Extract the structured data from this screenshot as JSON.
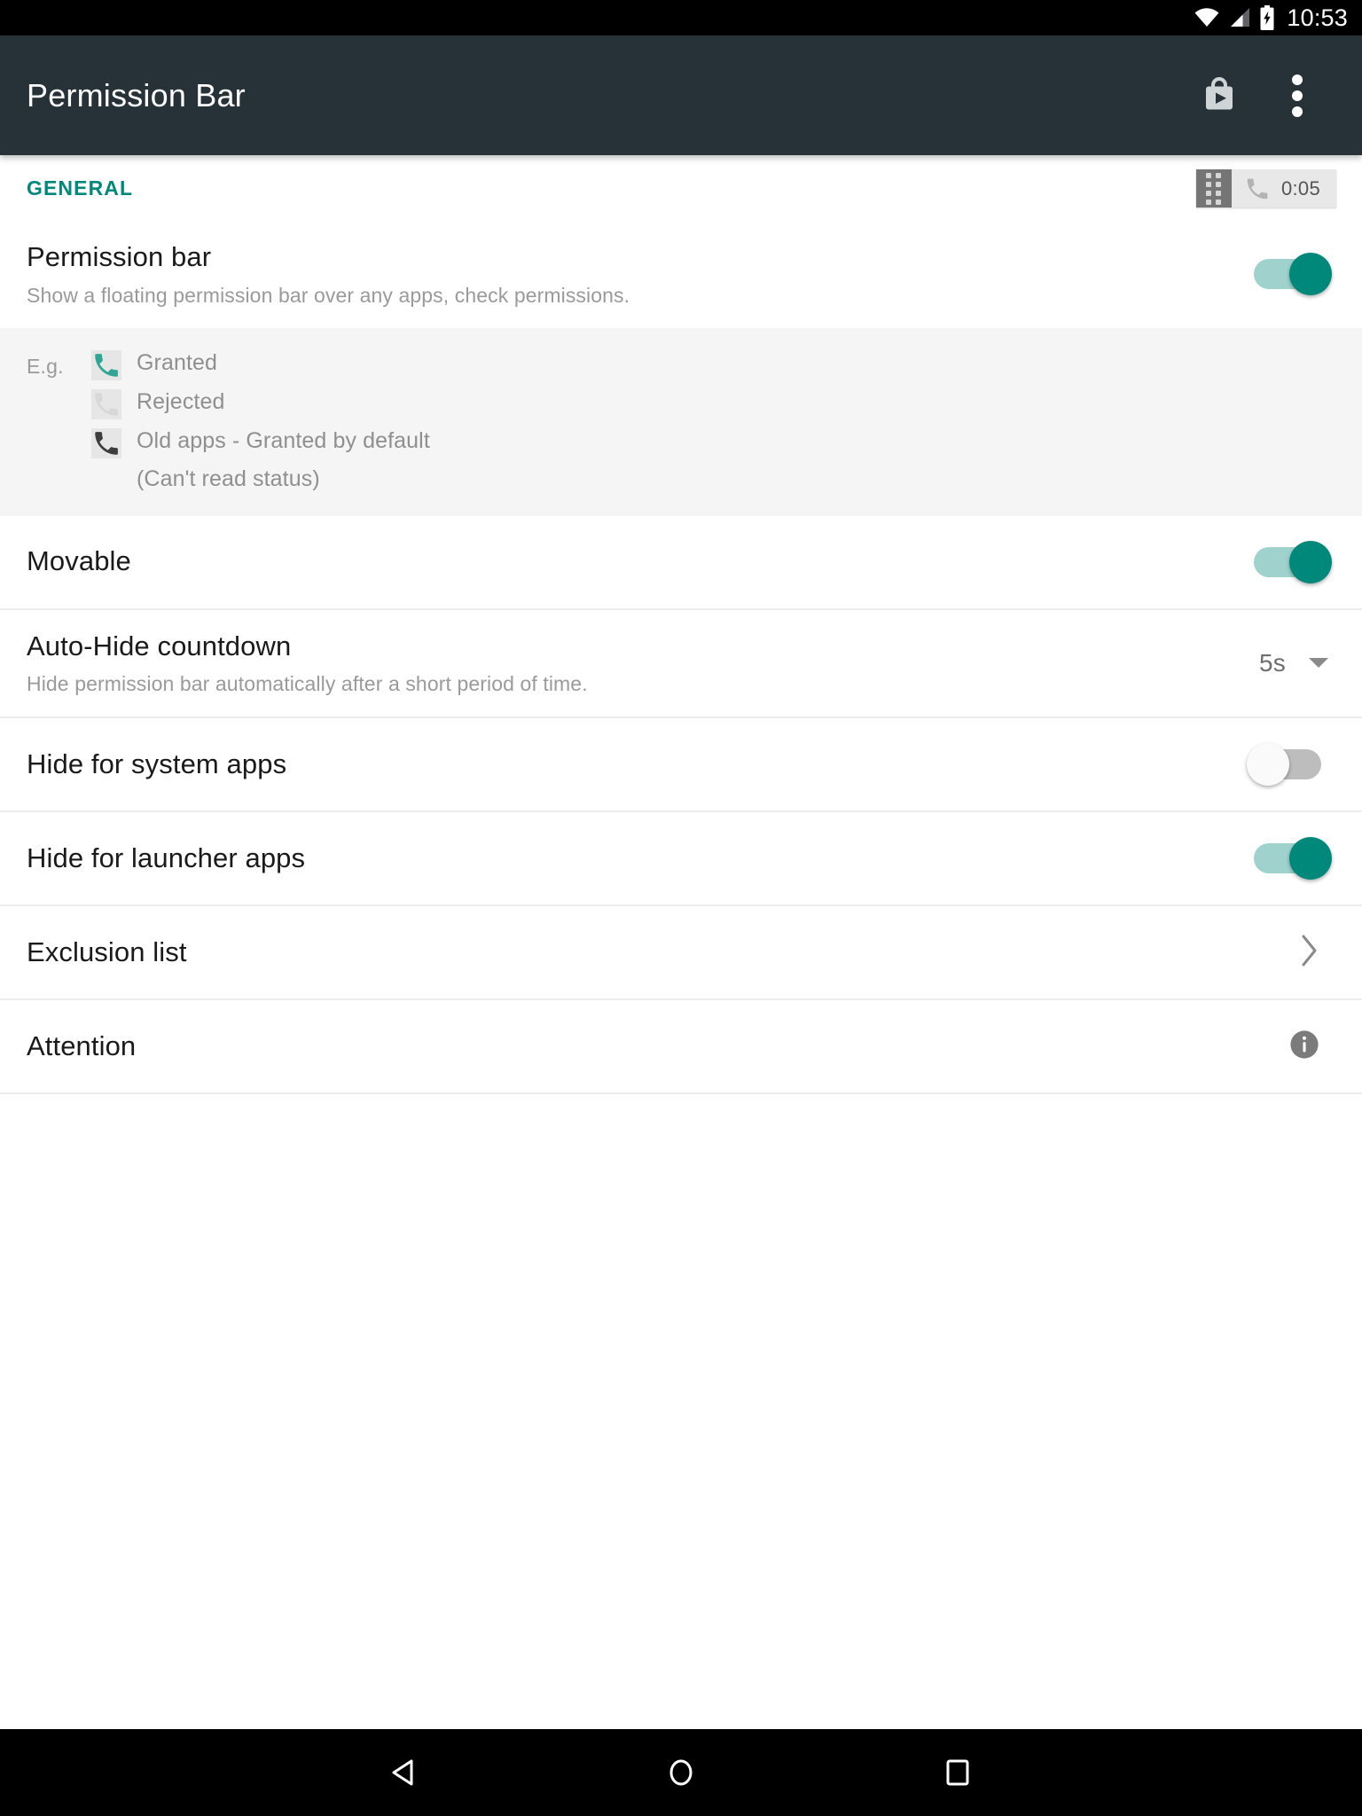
{
  "status_bar": {
    "time": "10:53",
    "icons": [
      "wifi-icon",
      "cellular-signal-icon",
      "battery-charging-icon"
    ]
  },
  "toolbar": {
    "title": "Permission Bar",
    "play_store_label": "Play Store",
    "overflow_label": "More options"
  },
  "general_section": {
    "header": "GENERAL",
    "preview_bar": {
      "handle_label": "drag-handle",
      "phone_icon_label": "phone",
      "timer": "0:05"
    }
  },
  "rows": {
    "permission_bar": {
      "title": "Permission bar",
      "subtitle": "Show a floating permission bar over any apps, check permissions.",
      "switch_state": "on"
    },
    "example": {
      "label": "E.g.",
      "items": [
        {
          "icon": "phone-icon-granted",
          "text": "Granted"
        },
        {
          "icon": "phone-icon-rejected",
          "text": "Rejected"
        },
        {
          "icon": "phone-icon-legacy",
          "text": "Old apps - Granted by default"
        }
      ],
      "note": "(Can't read status)"
    },
    "movable": {
      "title": "Movable",
      "switch_state": "on"
    },
    "auto_hide": {
      "title": "Auto-Hide countdown",
      "subtitle": "Hide permission bar automatically after a short period of time.",
      "value": "5s"
    },
    "hide_system": {
      "title": "Hide for system apps",
      "switch_state": "off"
    },
    "hide_launcher": {
      "title": "Hide for launcher apps",
      "switch_state": "on"
    },
    "exclusion_list": {
      "title": "Exclusion list"
    },
    "attention": {
      "title": "Attention"
    }
  },
  "nav_bar": {
    "back": "Back",
    "home": "Home",
    "recents": "Recent apps"
  },
  "colors": {
    "accent": "#00897B",
    "toolbar_bg": "#263238",
    "switch_track_on": "#9fd2cd",
    "eg_bg": "#f5f5f5"
  }
}
